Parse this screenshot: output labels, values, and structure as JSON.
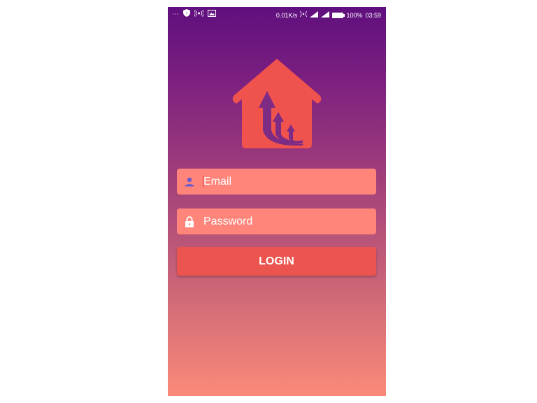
{
  "status_bar": {
    "left_icons": [
      "more-dots-icon",
      "shield-icon",
      "hotspot-icon",
      "image-icon"
    ],
    "network_speed": "0.01K/s",
    "battery_percent": "100%",
    "time": "03:59"
  },
  "form": {
    "email_placeholder": "Email",
    "password_placeholder": "Password",
    "login_label": "LOGIN"
  },
  "colors": {
    "gradient_top": "#5f0f7e",
    "gradient_bottom": "#fb8a78",
    "field_bg": "#ff857a",
    "button_bg": "#ec544f",
    "logo": "#f0524e",
    "icon_user": "#6a5acd"
  }
}
